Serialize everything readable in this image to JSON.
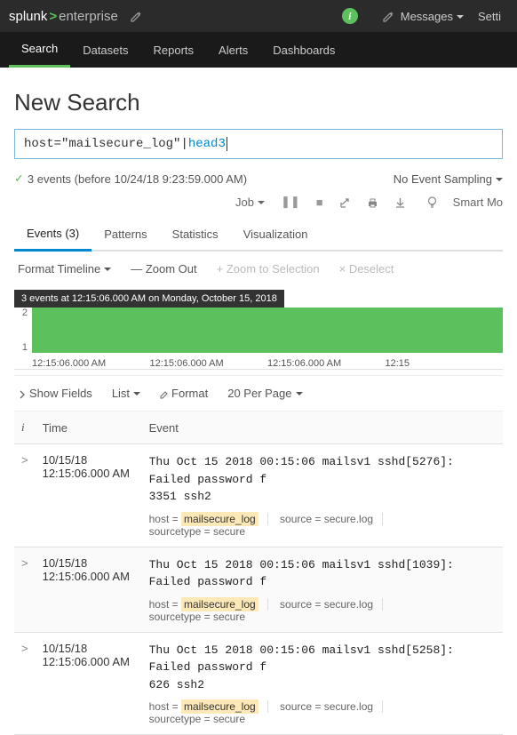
{
  "topbar": {
    "brand_left": "splunk",
    "brand_right": "enterprise",
    "messages": "Messages",
    "settings": "Setti"
  },
  "nav": {
    "search": "Search",
    "datasets": "Datasets",
    "reports": "Reports",
    "alerts": "Alerts",
    "dashboards": "Dashboards"
  },
  "page_title": "New Search",
  "search": {
    "part1": "host=\"mailsecure_log\"",
    "pipe": " | ",
    "cmd": "head",
    "num": " 3"
  },
  "status": {
    "text": "3 events (before 10/24/18 9:23:59.000 AM)",
    "sampling": "No Event Sampling"
  },
  "jobbar": {
    "job": "Job",
    "smart": "Smart Mo"
  },
  "tabs2": {
    "events": "Events (3)",
    "patterns": "Patterns",
    "statistics": "Statistics",
    "visualization": "Visualization"
  },
  "timeline_controls": {
    "format": "Format Timeline",
    "zoomout": "— Zoom Out",
    "zoomsel": "+ Zoom to Selection",
    "deselect": "× Deselect"
  },
  "timeline": {
    "tooltip": "3 events at 12:15:06.000 AM on Monday, October 15, 2018",
    "y2": "2",
    "y1": "1",
    "x1": "12:15:06.000 AM",
    "x2": "12:15:06.000 AM",
    "x3": "12:15:06.000 AM",
    "x4": "12:15"
  },
  "list_controls": {
    "showfields": "Show Fields",
    "list": "List",
    "format": "Format",
    "perpage": "20 Per Page"
  },
  "table": {
    "col_i": "i",
    "col_time": "Time",
    "col_event": "Event",
    "rows": [
      {
        "date": "10/15/18",
        "time": "12:15:06.000 AM",
        "raw1": "Thu Oct 15 2018 00:15:06 mailsv1 sshd[5276]: Failed password f",
        "raw2": "3351 ssh2",
        "host_label": "host = ",
        "host_value": "mailsecure_log",
        "source_label": "source = secure.log",
        "sourcetype_label": "sourcetype = secure"
      },
      {
        "date": "10/15/18",
        "time": "12:15:06.000 AM",
        "raw1": "Thu Oct 15 2018 00:15:06 mailsv1 sshd[1039]: Failed password f",
        "raw2": "",
        "host_label": "host = ",
        "host_value": "mailsecure_log",
        "source_label": "source = secure.log",
        "sourcetype_label": "sourcetype = secure"
      },
      {
        "date": "10/15/18",
        "time": "12:15:06.000 AM",
        "raw1": "Thu Oct 15 2018 00:15:06 mailsv1 sshd[5258]: Failed password f",
        "raw2": "626 ssh2",
        "host_label": "host = ",
        "host_value": "mailsecure_log",
        "source_label": "source = secure.log",
        "sourcetype_label": "sourcetype = secure"
      }
    ]
  },
  "chart_data": {
    "type": "bar",
    "categories": [
      "12:15:06.000 AM"
    ],
    "values": [
      3
    ],
    "ylim": [
      0,
      3
    ],
    "title": "",
    "xlabel": "",
    "ylabel": ""
  }
}
